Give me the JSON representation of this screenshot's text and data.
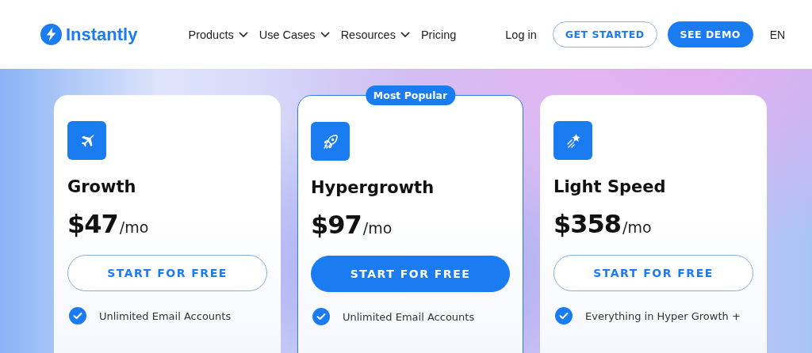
{
  "header": {
    "logo": "Instantly",
    "nav": [
      {
        "label": "Products",
        "dropdown": true
      },
      {
        "label": "Use Cases",
        "dropdown": true
      },
      {
        "label": "Resources",
        "dropdown": true
      },
      {
        "label": "Pricing",
        "dropdown": false
      }
    ],
    "login": "Log in",
    "get_started": "GET STARTED",
    "see_demo": "SEE DEMO",
    "language": "EN"
  },
  "plans": [
    {
      "kind": "plane",
      "name": "Growth",
      "price": "$47",
      "period": "/mo",
      "featured": false,
      "button": "START FOR FREE",
      "features": [
        "Unlimited Email Accounts"
      ]
    },
    {
      "kind": "rocket",
      "name": "Hypergrowth",
      "price": "$97",
      "period": "/mo",
      "featured": true,
      "badge": "Most Popular",
      "button": "START FOR FREE",
      "features": [
        "Unlimited Email Accounts"
      ]
    },
    {
      "kind": "star",
      "name": "Light Speed",
      "price": "$358",
      "period": "/mo",
      "featured": false,
      "button": "START FOR FREE",
      "features": [
        "Everything in Hyper Growth +"
      ]
    }
  ]
}
